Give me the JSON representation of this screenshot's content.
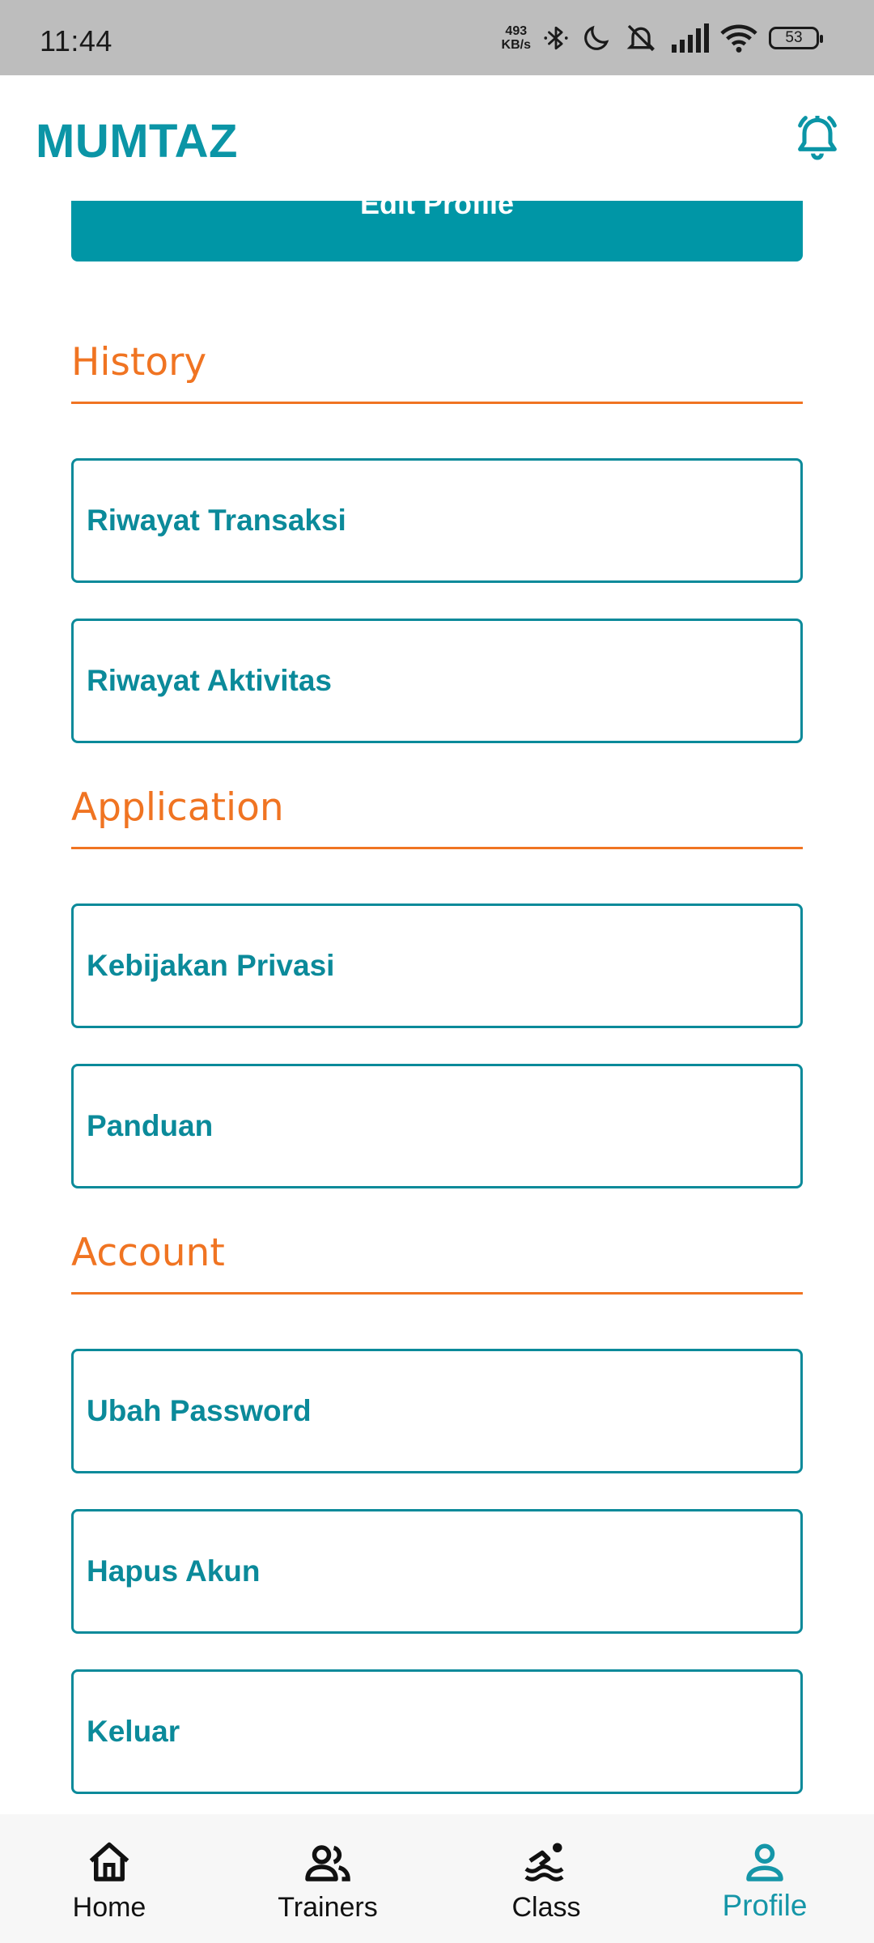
{
  "status_bar": {
    "time": "11:44",
    "net_speed_value": "493",
    "net_speed_unit": "KB/s",
    "battery": "53"
  },
  "app_bar": {
    "title": "MUMTAZ",
    "icon": "bell-icon"
  },
  "edit_profile_label": "Edit Profile",
  "sections": {
    "history": {
      "title": "History",
      "items": [
        "Riwayat Transaksi",
        "Riwayat Aktivitas"
      ]
    },
    "application": {
      "title": "Application",
      "items": [
        "Kebijakan Privasi",
        "Panduan"
      ]
    },
    "account": {
      "title": "Account",
      "items": [
        "Ubah Password",
        "Hapus Akun",
        "Keluar"
      ]
    }
  },
  "bottom_nav": {
    "active": "Profile",
    "items": [
      {
        "label": "Home",
        "icon": "home-icon"
      },
      {
        "label": "Trainers",
        "icon": "people-icon"
      },
      {
        "label": "Class",
        "icon": "swimming-icon"
      },
      {
        "label": "Profile",
        "icon": "person-icon"
      }
    ]
  },
  "colors": {
    "primary": "#0096a6",
    "accent": "#f07422",
    "nav_background": "#f7f7f7",
    "status_bar": "#bdbdbd"
  }
}
